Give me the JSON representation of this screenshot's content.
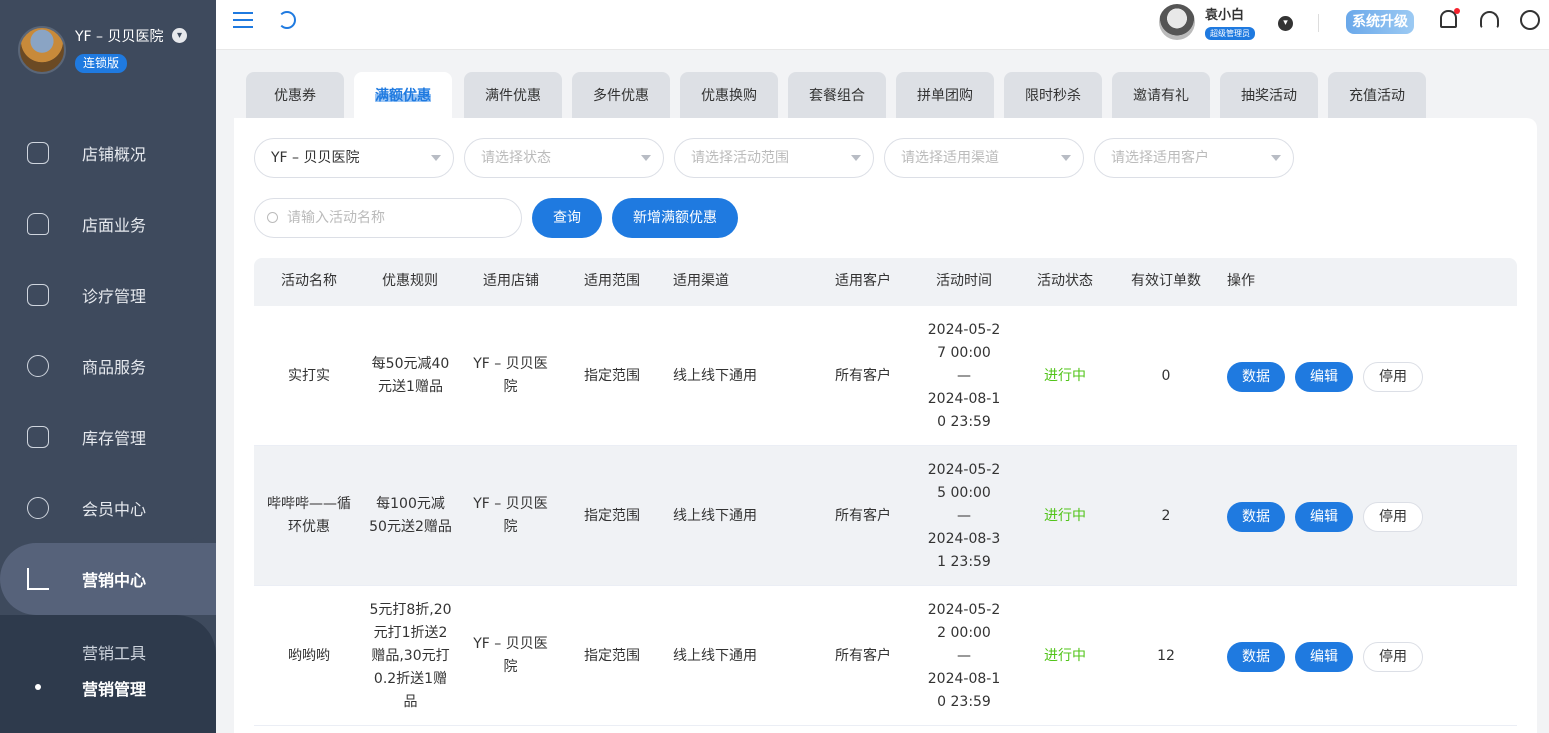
{
  "sidebar": {
    "store_name": "YF – 贝贝医院",
    "badge": "连锁版",
    "items": [
      {
        "label": "店铺概况",
        "icon": "monitor-icon"
      },
      {
        "label": "店面业务",
        "icon": "home-icon"
      },
      {
        "label": "诊疗管理",
        "icon": "medical-kit-icon"
      },
      {
        "label": "商品服务",
        "icon": "bag-icon"
      },
      {
        "label": "库存管理",
        "icon": "inventory-box-icon"
      },
      {
        "label": "会员中心",
        "icon": "member-icon"
      },
      {
        "label": "营销中心",
        "icon": "trend-chart-icon"
      }
    ],
    "sub_items": [
      {
        "label": "营销工具"
      },
      {
        "label": "营销管理"
      }
    ]
  },
  "topbar": {
    "user_name": "袁小白",
    "user_role": "超级管理员",
    "upgrade_label": "系统升级"
  },
  "tabs": [
    {
      "label": "优惠券"
    },
    {
      "label": "满额优惠"
    },
    {
      "label": "满件优惠"
    },
    {
      "label": "多件优惠"
    },
    {
      "label": "优惠换购"
    },
    {
      "label": "套餐组合"
    },
    {
      "label": "拼单团购"
    },
    {
      "label": "限时秒杀"
    },
    {
      "label": "邀请有礼"
    },
    {
      "label": "抽奖活动"
    },
    {
      "label": "充值活动"
    }
  ],
  "filters": {
    "store": "YF – 贝贝医院",
    "status_placeholder": "请选择状态",
    "scope_placeholder": "请选择活动范围",
    "channel_placeholder": "请选择适用渠道",
    "customer_placeholder": "请选择适用客户",
    "search_placeholder": "请输入活动名称",
    "query_label": "查询",
    "add_label": "新增满额优惠"
  },
  "table": {
    "headers": [
      "活动名称",
      "优惠规则",
      "适用店铺",
      "适用范围",
      "适用渠道",
      "适用客户",
      "活动时间",
      "活动状态",
      "有效订单数",
      "操作"
    ],
    "rows": [
      {
        "name": "实打实",
        "rule": "每50元减40元送1赠品",
        "store": "YF – 贝贝医院",
        "scope": "指定范围",
        "channel": "线上线下通用",
        "customer": "所有客户",
        "time_start_a": "2024-05-2",
        "time_start_b": "7 00:00",
        "time_sep": "—",
        "time_end_a": "2024-08-1",
        "time_end_b": "0 23:59",
        "status": "进行中",
        "orders": "0"
      },
      {
        "name": "哔哔哔——循环优惠",
        "rule": "每100元减50元送2赠品",
        "store": "YF – 贝贝医院",
        "scope": "指定范围",
        "channel": "线上线下通用",
        "customer": "所有客户",
        "time_start_a": "2024-05-2",
        "time_start_b": "5 00:00",
        "time_sep": "—",
        "time_end_a": "2024-08-3",
        "time_end_b": "1 23:59",
        "status": "进行中",
        "orders": "2"
      },
      {
        "name": "哟哟哟",
        "rule": "5元打8折,20元打1折送2赠品,30元打0.2折送1赠品",
        "store": "YF – 贝贝医院",
        "scope": "指定范围",
        "channel": "线上线下通用",
        "customer": "所有客户",
        "time_start_a": "2024-05-2",
        "time_start_b": "2 00:00",
        "time_sep": "—",
        "time_end_a": "2024-08-1",
        "time_end_b": "0 23:59",
        "status": "进行中",
        "orders": "12"
      }
    ],
    "actions": {
      "data": "数据",
      "edit": "编辑",
      "disable": "停用"
    }
  },
  "colors": {
    "accent": "#1f7ae0",
    "sidebar": "#3e4a5d",
    "status_on": "#52c41a"
  }
}
